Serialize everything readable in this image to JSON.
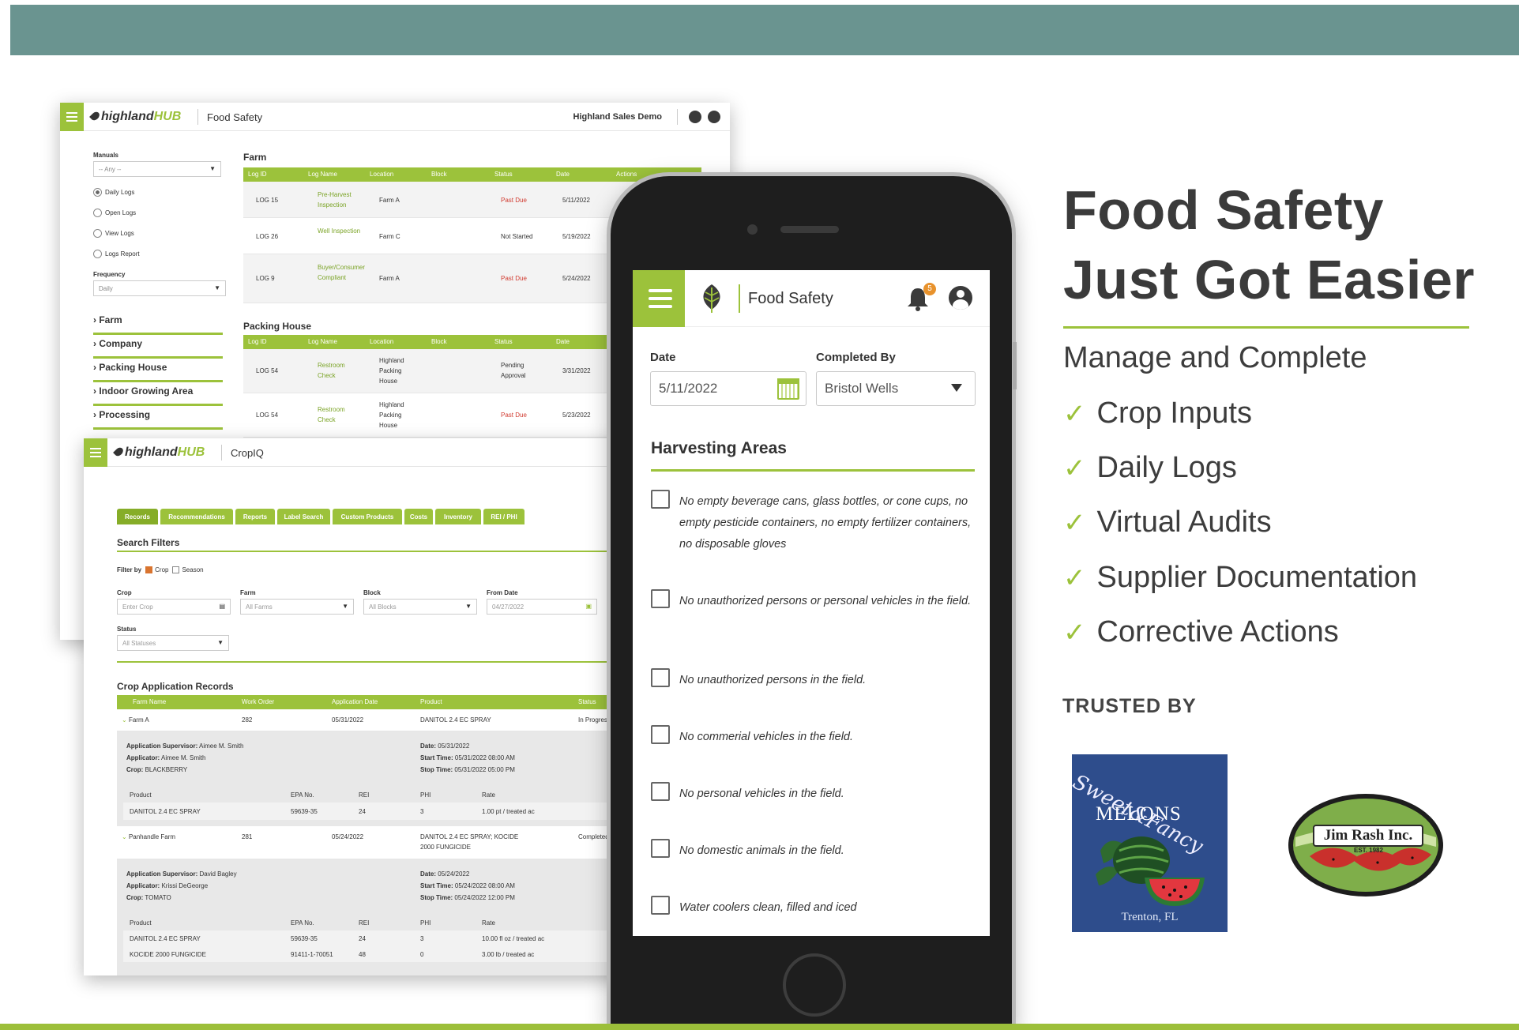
{
  "colors": {
    "teal_banner": "#6a9490",
    "brand_green": "#9cc23b",
    "past_due_red": "#d13a2f",
    "text_dark": "#3b3b3b"
  },
  "food_safety_screen": {
    "brand": {
      "name": "highland",
      "hub": "HUB"
    },
    "module": "Food Safety",
    "account": "Highland Sales Demo",
    "icons": [
      "notification-icon",
      "user-icon"
    ],
    "sidebar": {
      "manuals_label": "Manuals",
      "manuals_value": "-- Any --",
      "radios": [
        "Daily Logs",
        "Open Logs",
        "View Logs",
        "Logs Report"
      ],
      "selected_radio": "Daily Logs",
      "frequency_label": "Frequency",
      "frequency_value": "Daily",
      "categories": [
        "Farm",
        "Company",
        "Packing House",
        "Indoor Growing Area",
        "Processing"
      ]
    },
    "columns": [
      "Log ID",
      "Log Name",
      "Location",
      "Block",
      "Status",
      "Date",
      "Actions"
    ],
    "farm": {
      "title": "Farm",
      "rows": [
        {
          "id": "LOG 15",
          "name": "Pre-Harvest Inspection",
          "location": "Farm A",
          "status": "Past Due",
          "date": "5/11/2022"
        },
        {
          "id": "LOG 26",
          "name": "Well Inspection",
          "location": "Farm C",
          "status": "Not Started",
          "date": "5/19/2022"
        },
        {
          "id": "LOG 9",
          "name": "Buyer/Consumer Compliant",
          "location": "Farm A",
          "status": "Past Due",
          "date": "5/24/2022"
        }
      ]
    },
    "packing": {
      "title": "Packing House",
      "rows": [
        {
          "id": "LOG 54",
          "name": "Restroom Check",
          "location": "Highland Packing House",
          "status": "Pending Approval",
          "date": "3/31/2022"
        },
        {
          "id": "LOG 54",
          "name": "Restroom Check",
          "location": "Highland Packing House",
          "status": "Past Due",
          "date": "5/23/2022"
        }
      ]
    }
  },
  "cropiq_screen": {
    "brand": {
      "name": "highland",
      "hub": "HUB"
    },
    "module": "CropIQ",
    "tabs": [
      "Records",
      "Recommendations",
      "Reports",
      "Label Search",
      "Custom Products",
      "Costs",
      "Inventory",
      "REI / PHI"
    ],
    "filters": {
      "title": "Search Filters",
      "filter_by": "Filter by",
      "crop_opt": "Crop",
      "season_opt": "Season",
      "crop_label": "Crop",
      "crop_placeholder": "Enter Crop",
      "farm_label": "Farm",
      "farm_value": "All Farms",
      "block_label": "Block",
      "block_value": "All Blocks",
      "from_label": "From Date",
      "from_value": "04/27/2022",
      "status_label": "Status",
      "status_value": "All Statuses"
    },
    "records": {
      "title": "Crop Application Records",
      "columns": [
        "Farm Name",
        "Work Order",
        "Application Date",
        "Product",
        "Status"
      ],
      "product_columns": [
        "Product",
        "EPA No.",
        "REI",
        "PHI",
        "Rate"
      ],
      "rows": [
        {
          "farm": "Farm A",
          "work_order": "282",
          "date": "05/31/2022",
          "product": "DANITOL 2.4 EC SPRAY",
          "status": "In Progress",
          "supervisor_label": "Application Supervisor:",
          "supervisor": "Aimee M. Smith",
          "applicator_label": "Applicator:",
          "applicator": "Aimee M. Smith",
          "crop_label": "Crop:",
          "crop": "BLACKBERRY",
          "d_date_label": "Date:",
          "d_date": "05/31/2022",
          "start_label": "Start Time:",
          "start": "05/31/2022 08:00 AM",
          "stop_label": "Stop Time:",
          "stop": "05/31/2022 05:00 PM",
          "products": [
            {
              "name": "DANITOL 2.4 EC SPRAY",
              "epa": "59639-35",
              "rei": "24",
              "phi": "3",
              "rate": "1.00 pt / treated ac"
            }
          ]
        },
        {
          "farm": "Panhandle Farm",
          "work_order": "281",
          "date": "05/24/2022",
          "product": "DANITOL 2.4 EC SPRAY; KOCIDE 2000 FUNGICIDE",
          "status": "Completed",
          "supervisor_label": "Application Supervisor:",
          "supervisor": "David Bagley",
          "applicator_label": "Applicator:",
          "applicator": "Krissi DeGeorge",
          "crop_label": "Crop:",
          "crop": "TOMATO",
          "d_date_label": "Date:",
          "d_date": "05/24/2022",
          "start_label": "Start Time:",
          "start": "05/24/2022 08:00 AM",
          "stop_label": "Stop Time:",
          "stop": "05/24/2022 12:00 PM",
          "products": [
            {
              "name": "DANITOL 2.4 EC SPRAY",
              "epa": "59639-35",
              "rei": "24",
              "phi": "3",
              "rate": "10.00 fl oz / treated ac"
            },
            {
              "name": "KOCIDE 2000 FUNGICIDE",
              "epa": "91411-1-70051",
              "rei": "48",
              "phi": "0",
              "rate": "3.00 lb / treated ac"
            }
          ]
        }
      ]
    }
  },
  "phone": {
    "title": "Food Safety",
    "notification_count": "5",
    "date_label": "Date",
    "date_value": "5/11/2022",
    "completed_label": "Completed By",
    "completed_value": "Bristol Wells",
    "section_title": "Harvesting Areas",
    "checklist": [
      "No empty beverage cans, glass bottles, or cone cups, no empty pesticide containers, no empty fertilizer containers, no disposable gloves",
      "No unauthorized persons or personal vehicles in the field.",
      "No unauthorized persons in the field.",
      "No commerial vehicles in the field.",
      "No personal vehicles in the field.",
      "No domestic animals in the field.",
      "Water coolers clean, filled and iced"
    ]
  },
  "marketing": {
    "headline_line1": "Food Safety",
    "headline_line2": "Just Got Easier",
    "subhead": "Manage and Complete",
    "features": [
      "Crop Inputs",
      "Daily Logs",
      "Virtual Audits",
      "Supplier Documentation",
      "Corrective Actions"
    ],
    "trusted_by": "TRUSTED BY",
    "logos": [
      {
        "name": "Sweet & Fancy Melons",
        "script": "Sweet&Fancy",
        "word": "MELONS",
        "town": "Trenton, FL"
      },
      {
        "name": "Jim Rash Inc.",
        "word": "Jim Rash Inc.",
        "est": "EST. 1982"
      }
    ]
  }
}
